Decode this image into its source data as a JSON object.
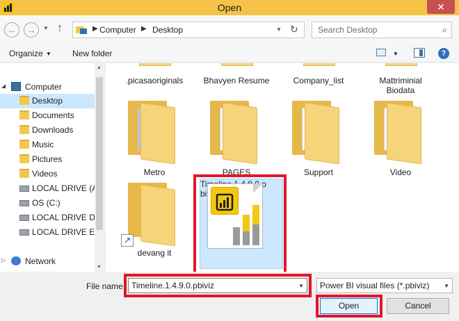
{
  "window": {
    "title": "Open",
    "close_glyph": "✕"
  },
  "address": {
    "segments": [
      "Computer",
      "Desktop"
    ],
    "search_placeholder": "Search Desktop"
  },
  "toolbar": {
    "organize": "Organize",
    "new_folder": "New folder"
  },
  "nav": {
    "items": [
      {
        "label": "Computer",
        "icon": "computer-icon"
      },
      {
        "label": "Desktop",
        "icon": "folder-icon",
        "selected": true
      },
      {
        "label": "Documents",
        "icon": "folder-icon"
      },
      {
        "label": "Downloads",
        "icon": "folder-icon"
      },
      {
        "label": "Music",
        "icon": "folder-icon"
      },
      {
        "label": "Pictures",
        "icon": "folder-icon"
      },
      {
        "label": "Videos",
        "icon": "folder-icon"
      },
      {
        "label": "LOCAL DRIVE (A:",
        "icon": "drive-icon"
      },
      {
        "label": "OS (C:)",
        "icon": "drive-icon"
      },
      {
        "label": "LOCAL DRIVE D (",
        "icon": "drive-icon"
      },
      {
        "label": "LOCAL DRIVE E (I",
        "icon": "drive-icon"
      },
      {
        "label": "Network",
        "icon": "network-icon"
      }
    ]
  },
  "files": {
    "row1": [
      ".picasaoriginals",
      "Bhavyen Resume",
      "Company_list",
      "Mattriminial Biodata"
    ],
    "row2": [
      "Metro",
      "PAGES",
      "Support",
      "Video"
    ],
    "row3": [
      "devang it"
    ],
    "selected": {
      "line1": "Timeline.1.4.9.0.p",
      "line2": "biviz"
    }
  },
  "bottom": {
    "file_name_label": "File name:",
    "file_name_value": "Timeline.1.4.9.0.pbiviz",
    "filter": "Power BI visual files (*.pbiviz)",
    "open": "Open",
    "cancel": "Cancel"
  },
  "colors": {
    "accent": "#e0162b",
    "titlebar": "#f6c247",
    "selection": "#cce8ff"
  }
}
